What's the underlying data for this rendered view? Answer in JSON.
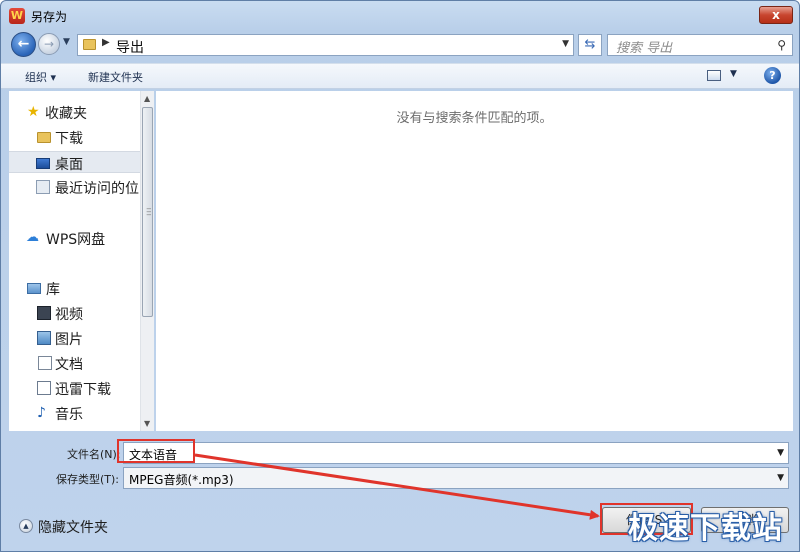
{
  "window": {
    "title": "另存为",
    "app_icon_glyph": "W",
    "close_glyph": "x"
  },
  "address": {
    "path": "导出",
    "search_placeholder": "搜索 导出"
  },
  "toolbar": {
    "organize": "组织 ▾",
    "new_folder": "新建文件夹",
    "help": "?"
  },
  "sidebar": {
    "items": [
      {
        "label": "收藏夹",
        "icon": "star-icon"
      },
      {
        "label": "下载",
        "icon": "folder-icon"
      },
      {
        "label": "桌面",
        "icon": "desktop-icon",
        "selected": true
      },
      {
        "label": "最近访问的位",
        "icon": "recent-places-icon"
      },
      {
        "label": "WPS网盘",
        "icon": "cloud-icon"
      },
      {
        "label": "库",
        "icon": "library-icon"
      },
      {
        "label": "视频",
        "icon": "video-icon"
      },
      {
        "label": "图片",
        "icon": "picture-icon"
      },
      {
        "label": "文档",
        "icon": "document-icon"
      },
      {
        "label": "迅雷下载",
        "icon": "thunder-download-icon"
      },
      {
        "label": "音乐",
        "icon": "music-icon"
      }
    ]
  },
  "main": {
    "empty_message": "没有与搜索条件匹配的项。"
  },
  "form": {
    "filename_label": "文件名(N):",
    "filename_value": "文本语音",
    "filetype_label": "保存类型(T):",
    "filetype_value": "MPEG音频(*.mp3)",
    "hide_folders": "隐藏文件夹",
    "save_button": "保存(S)",
    "cancel_button": "取消"
  },
  "watermark": "极速下载站",
  "colors": {
    "annotation_red": "#e0342b",
    "accent_blue": "#2a64b8"
  }
}
